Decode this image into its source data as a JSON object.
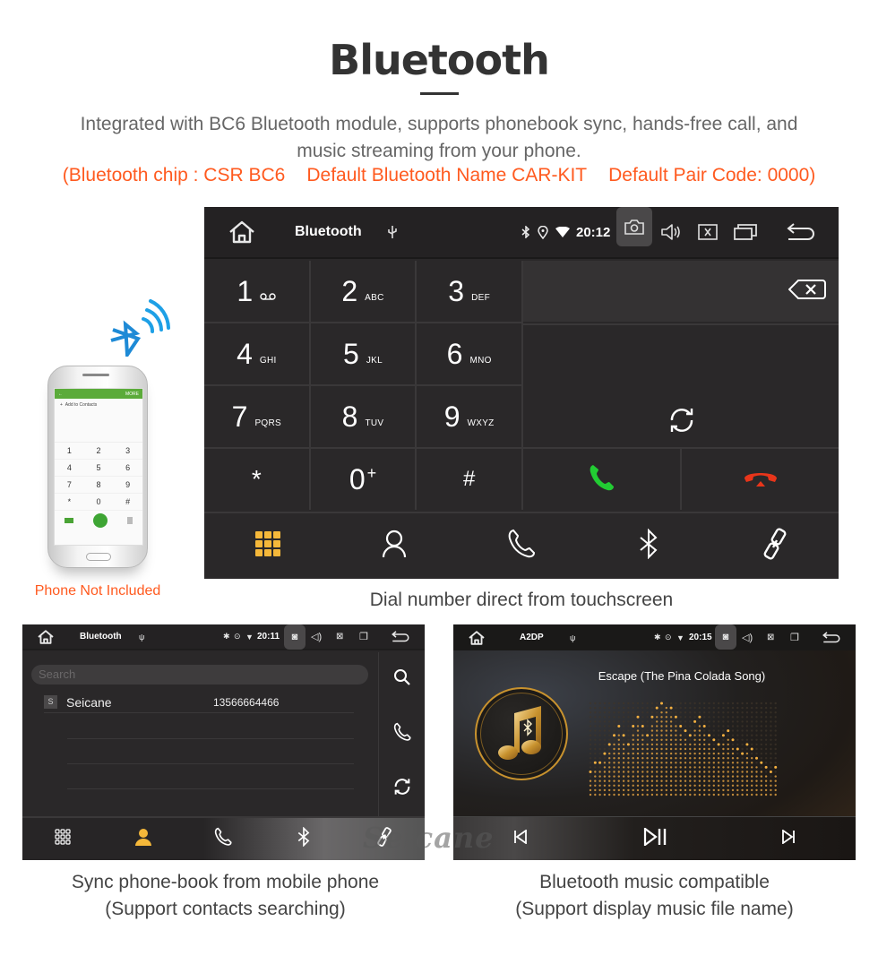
{
  "header": {
    "title": "Bluetooth",
    "subtitle_line1": "Integrated with BC6 Bluetooth module, supports phonebook sync, hands-free call, and",
    "subtitle_line2": "music streaming from your phone.",
    "specs": [
      "(Bluetooth chip : CSR BC6",
      "Default Bluetooth Name CAR-KIT",
      "Default Pair Code: 0000)"
    ]
  },
  "colors": {
    "accent_orange": "#ff5a1f",
    "screen_bg": "#2a2829",
    "call_green": "#22cc33",
    "hangup_red": "#e8351a",
    "active_tab_yellow": "#f5b83a"
  },
  "dialer": {
    "status": {
      "title": "Bluetooth",
      "time": "20:12",
      "icons": [
        "home-icon",
        "usb-icon",
        "bluetooth-icon",
        "location-icon",
        "wifi-icon",
        "camera-icon",
        "volume-icon",
        "close-box-icon",
        "recent-apps-icon",
        "back-icon"
      ]
    },
    "keys": [
      {
        "num": "1",
        "sub": "voicemail"
      },
      {
        "num": "2",
        "sub": "ABC"
      },
      {
        "num": "3",
        "sub": "DEF"
      },
      {
        "num": "4",
        "sub": "GHI"
      },
      {
        "num": "5",
        "sub": "JKL"
      },
      {
        "num": "6",
        "sub": "MNO"
      },
      {
        "num": "7",
        "sub": "PQRS"
      },
      {
        "num": "8",
        "sub": "TUV"
      },
      {
        "num": "9",
        "sub": "WXYZ"
      },
      {
        "num": "*",
        "sub": ""
      },
      {
        "num": "0",
        "sup": "+"
      },
      {
        "num": "#",
        "sub": ""
      }
    ],
    "number_value": "",
    "tabs": [
      "keypad",
      "contacts",
      "call-log",
      "bluetooth",
      "link"
    ],
    "active_tab": "keypad",
    "caption": "Dial number direct from touchscreen"
  },
  "phone_illustration": {
    "bar_left": "←",
    "bar_right": "MORE",
    "add_contacts": "Add to Contacts",
    "keys": [
      "1",
      "2",
      "3",
      "4",
      "5",
      "6",
      "7",
      "8",
      "9",
      "*",
      "0",
      "#"
    ],
    "note": "Phone Not Included"
  },
  "contacts_screen": {
    "status": {
      "title": "Bluetooth",
      "time": "20:11"
    },
    "search_placeholder": "Search",
    "contacts": [
      {
        "initial": "S",
        "name": "Seicane",
        "phone": "13566664466"
      }
    ],
    "active_tab": "contacts",
    "caption_line1": "Sync phone-book from mobile phone",
    "caption_line2": "(Support contacts searching)"
  },
  "music_screen": {
    "status": {
      "title": "A2DP",
      "time": "20:15"
    },
    "song_title": "Escape (The Pina Colada Song)",
    "controls": [
      "previous",
      "play-pause",
      "next"
    ],
    "caption_line1": "Bluetooth music compatible",
    "caption_line2": "(Support display music file name)"
  },
  "watermark": "Seicane"
}
